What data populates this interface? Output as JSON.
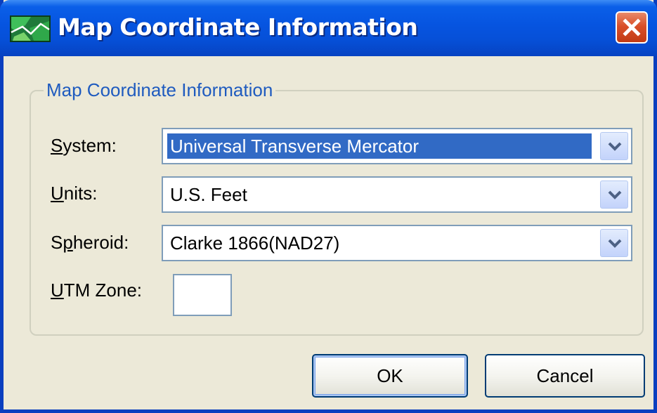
{
  "window": {
    "title": "Map Coordinate Information",
    "icon": "map-icon",
    "close_icon": "close-icon"
  },
  "group": {
    "legend": "Map Coordinate Information"
  },
  "fields": {
    "system": {
      "label_mnemonic": "S",
      "label_rest": "ystem:",
      "value": "Universal Transverse Mercator",
      "selected": true
    },
    "units": {
      "label_mnemonic": "U",
      "label_rest": "nits:",
      "value": "U.S. Feet"
    },
    "spheroid": {
      "label_pre": "S",
      "label_mnemonic": "p",
      "label_rest": "heroid:",
      "value": "Clarke 1866(NAD27)"
    },
    "utm_zone": {
      "label_mnemonic": "U",
      "label_rest": "TM Zone:",
      "value": ""
    }
  },
  "buttons": {
    "ok": "OK",
    "cancel": "Cancel"
  },
  "colors": {
    "title_bar": "#0654e0",
    "window_bg": "#ece9d8",
    "legend_text": "#1f5bbf",
    "selection": "#316ac5",
    "close_button": "#d9502a"
  }
}
